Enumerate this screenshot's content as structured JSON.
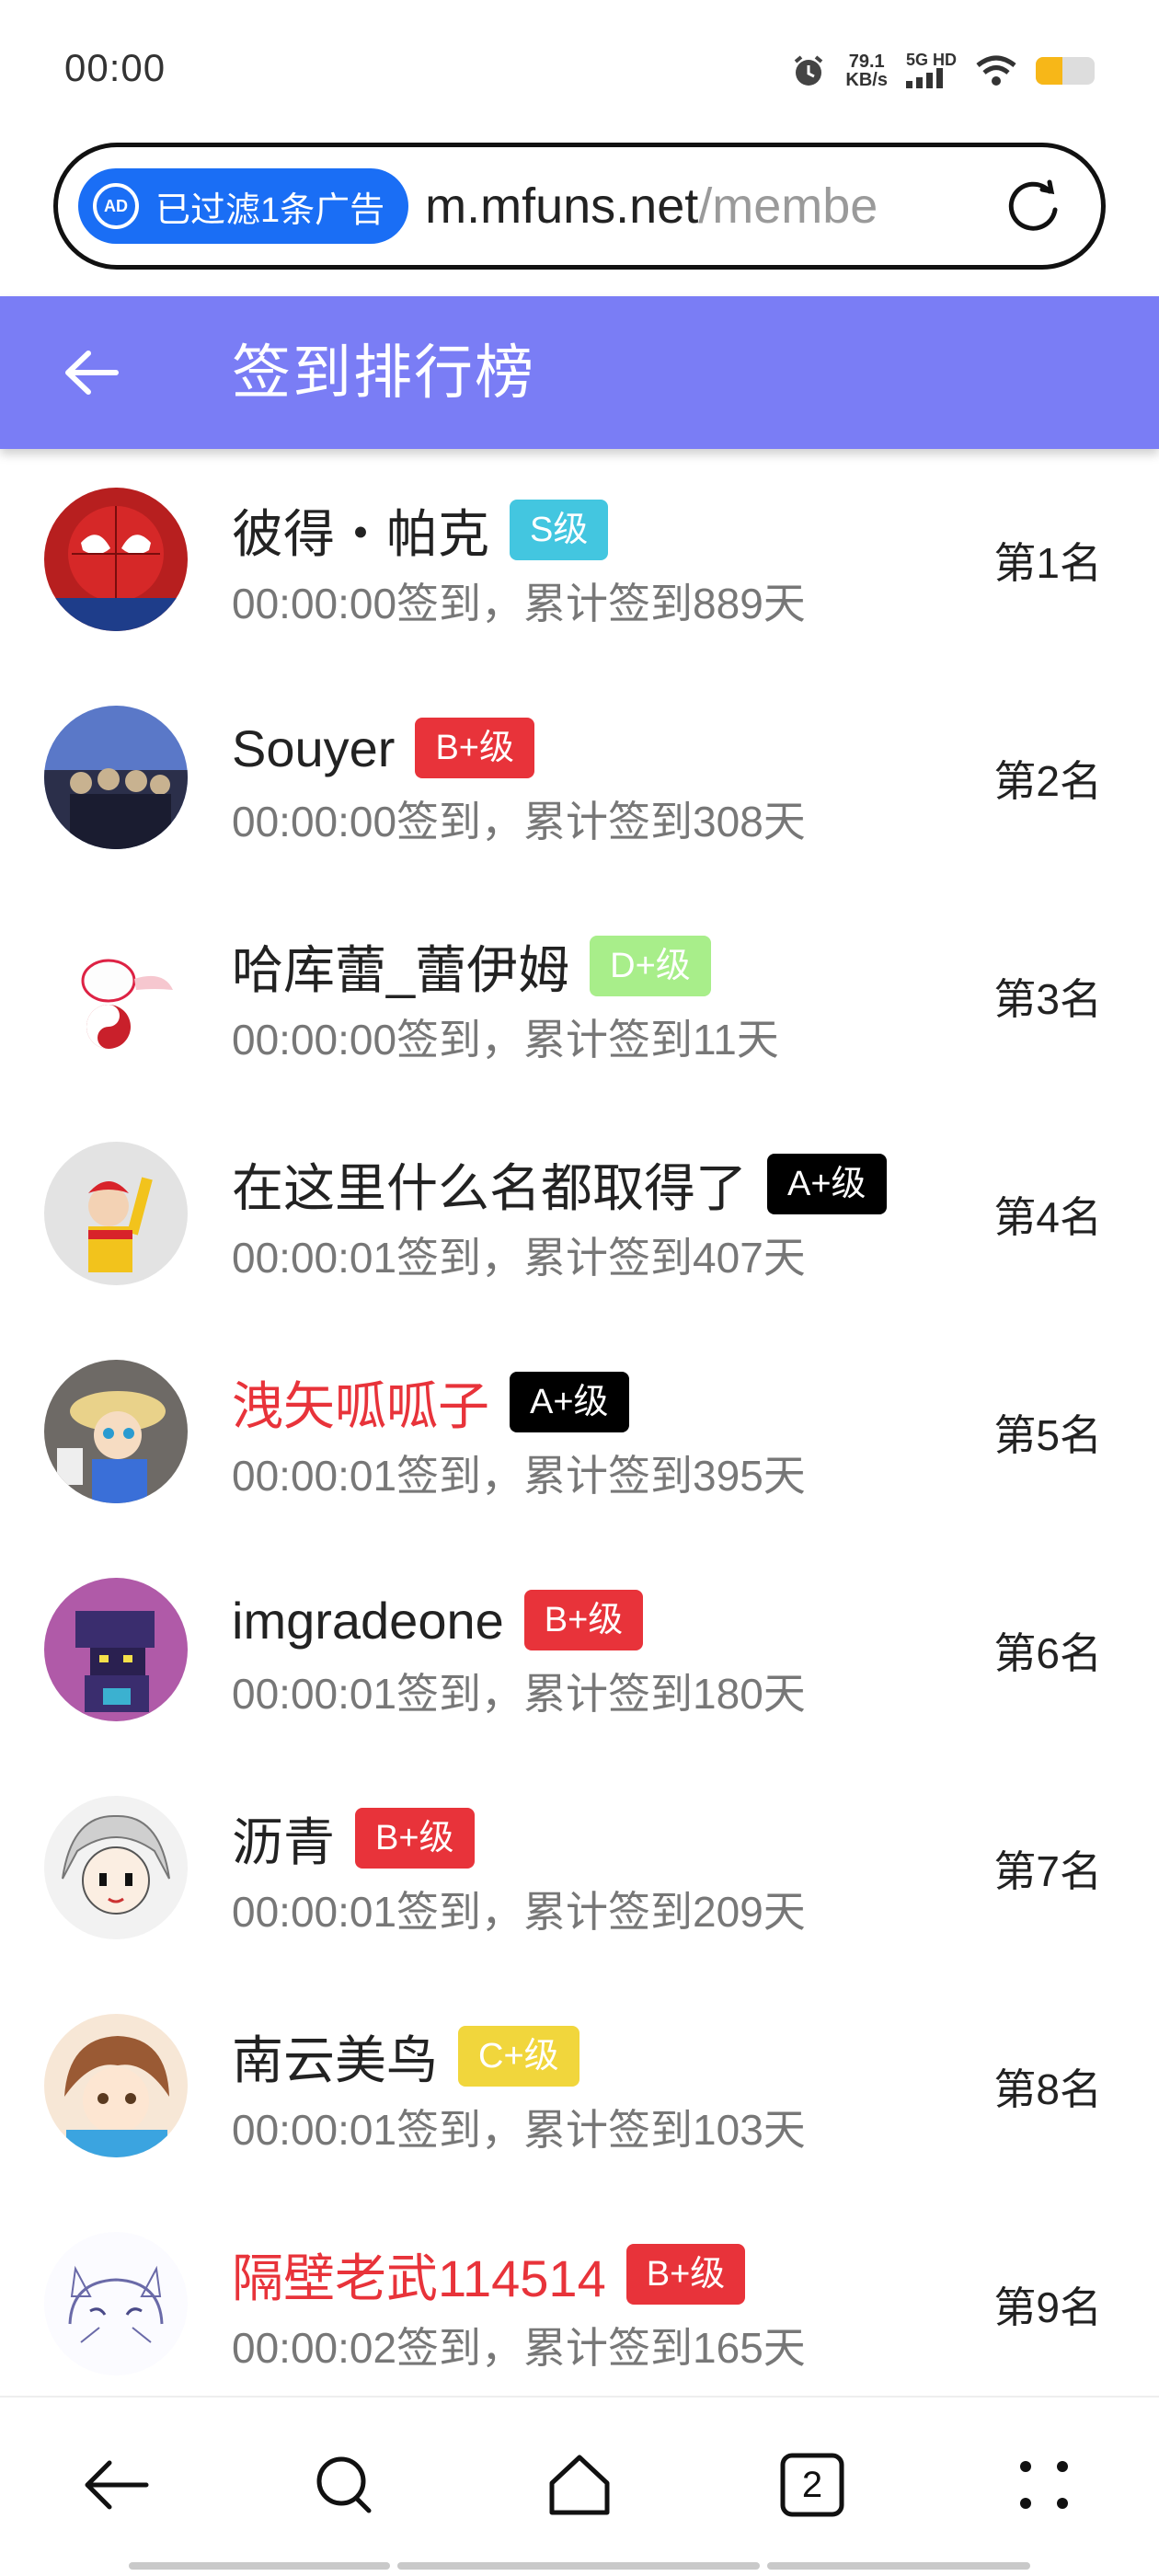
{
  "status": {
    "time": "00:00",
    "netspeed_value": "79.1",
    "netspeed_unit": "KB/s",
    "network": "5G HD",
    "battery_level": 0.45,
    "battery_color": "#f7b718"
  },
  "urlbar": {
    "ad_badge": "已过滤1条广告",
    "ad_icon_text": "AD",
    "domain": "m.mfuns.net",
    "path": "/membe"
  },
  "header": {
    "title": "签到排行榜",
    "bg_color": "#7a7df5"
  },
  "colors": {
    "S": "#43c6e0",
    "B+": "#e8333a",
    "D+": "#a8ee8a",
    "A+": "#000000",
    "C+": "#f1d63c",
    "red_name": "#e8333a"
  },
  "rows": [
    {
      "name": "彼得・帕克",
      "level": "S级",
      "sub": "00:00:00签到，累计签到889天",
      "rank": "第1名"
    },
    {
      "name": "Souyer",
      "level": "B+级",
      "sub": "00:00:00签到，累计签到308天",
      "rank": "第2名"
    },
    {
      "name": "哈库蕾_蕾伊姆",
      "level": "D+级",
      "sub": "00:00:00签到，累计签到11天",
      "rank": "第3名"
    },
    {
      "name": "在这里什么名都取得了",
      "level": "A+级",
      "sub": "00:00:01签到，累计签到407天",
      "rank": "第4名"
    },
    {
      "name": "洩矢呱呱子",
      "level": "A+级",
      "sub": "00:00:01签到，累计签到395天",
      "rank": "第5名"
    },
    {
      "name": "imgradeone",
      "level": "B+级",
      "sub": "00:00:01签到，累计签到180天",
      "rank": "第6名"
    },
    {
      "name": "沥青",
      "level": "B+级",
      "sub": "00:00:01签到，累计签到209天",
      "rank": "第7名"
    },
    {
      "name": "南云美鸟",
      "level": "C+级",
      "sub": "00:00:01签到，累计签到103天",
      "rank": "第8名"
    },
    {
      "name": "隔壁老武114514",
      "level": "B+级",
      "sub": "00:00:02签到，累计签到165天",
      "rank": "第9名"
    }
  ],
  "bottomnav": {
    "tabs_count": "2",
    "icons": [
      "back-icon",
      "search-icon",
      "home-icon",
      "tabs-icon",
      "menu-icon"
    ]
  }
}
